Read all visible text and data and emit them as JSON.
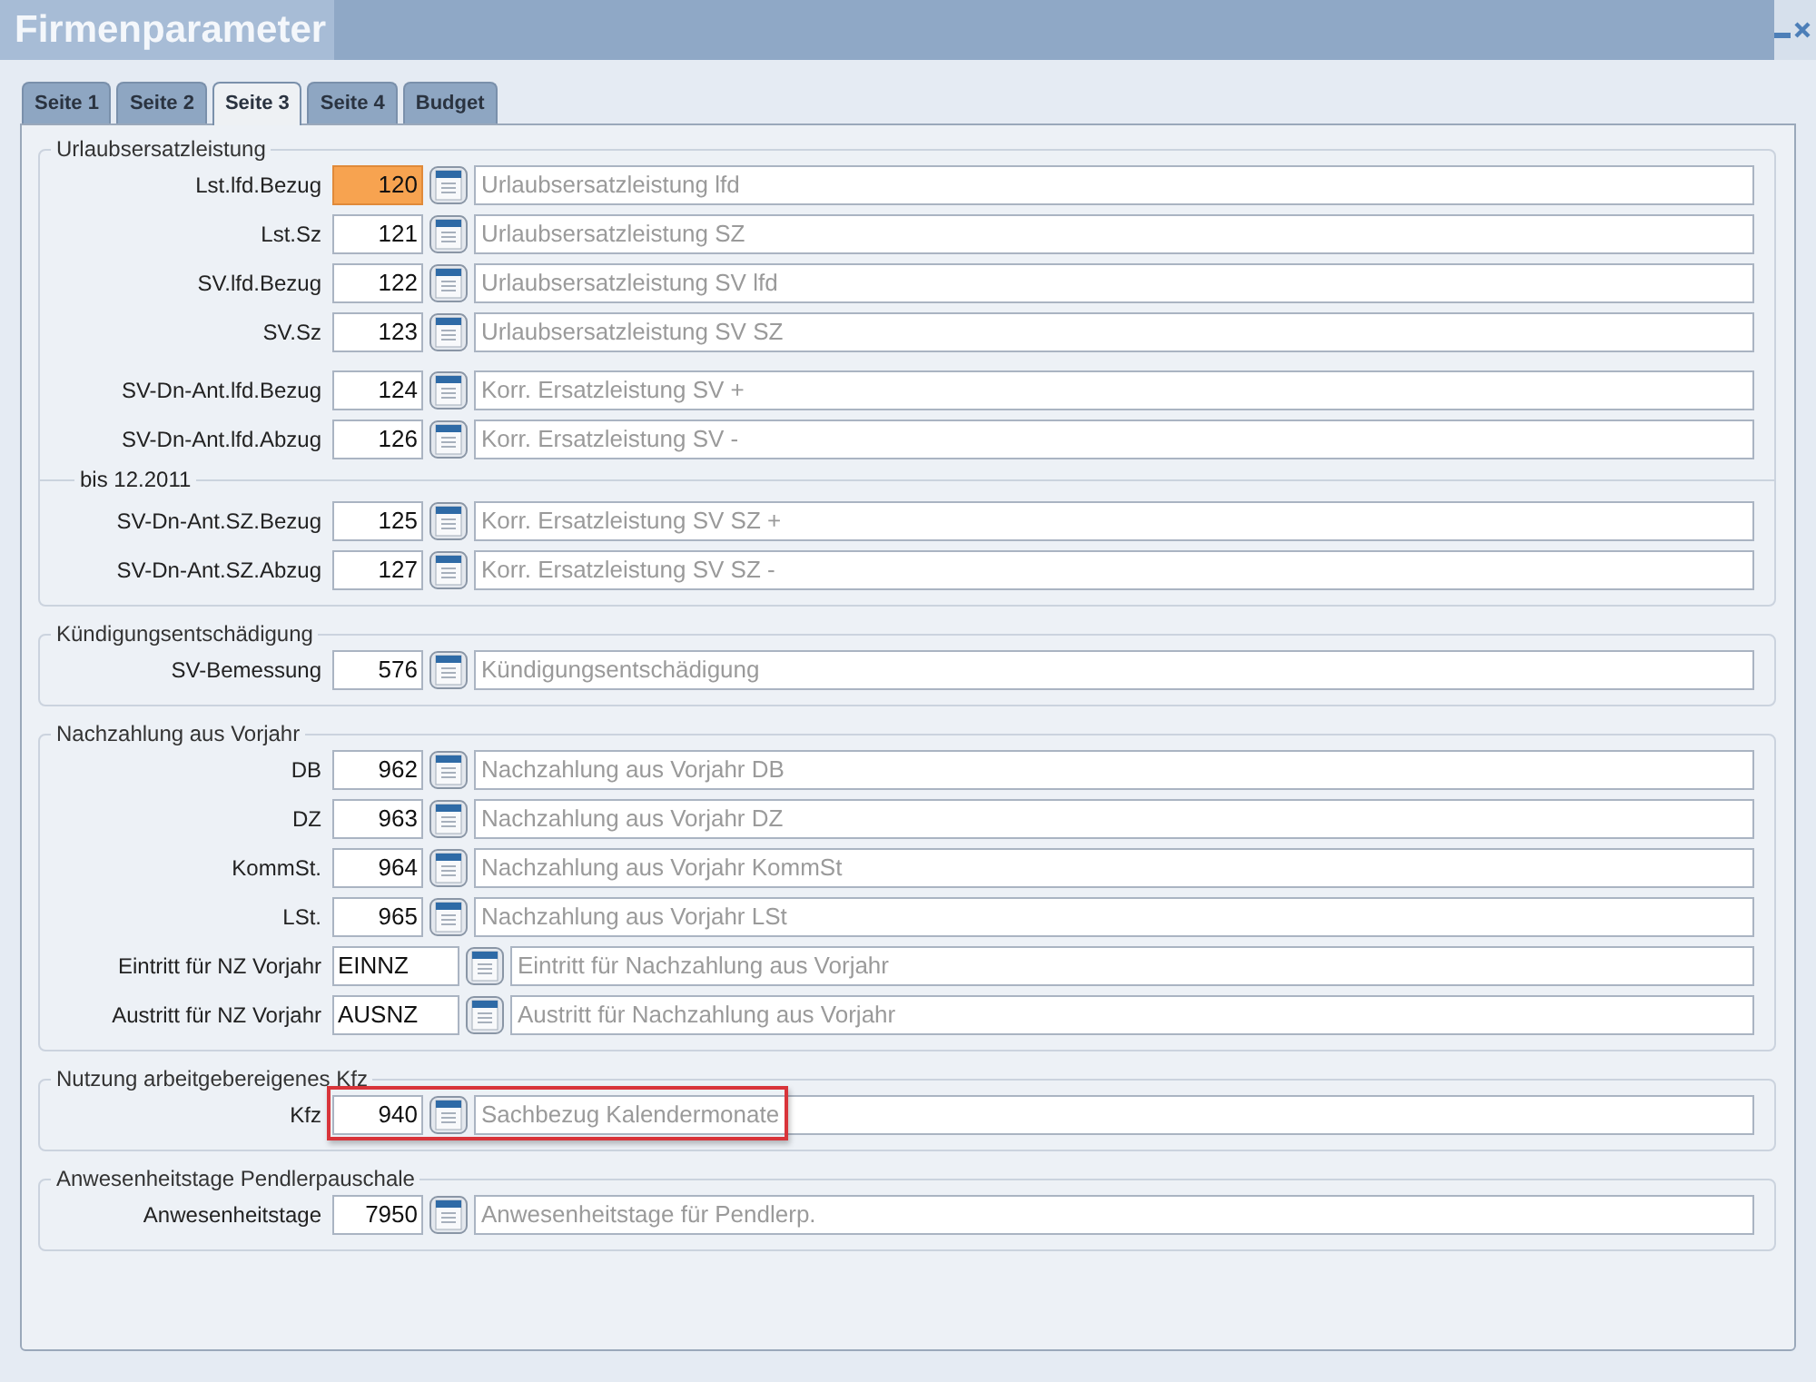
{
  "window": {
    "title": "Firmenparameter"
  },
  "tabs": [
    {
      "label": "Seite 1",
      "selected": false
    },
    {
      "label": "Seite 2",
      "selected": false
    },
    {
      "label": "Seite 3",
      "selected": true
    },
    {
      "label": "Seite 4",
      "selected": false
    },
    {
      "label": "Budget",
      "selected": false
    }
  ],
  "sections": [
    {
      "legend": "Urlaubsersatzleistung",
      "groups": [
        {
          "rows": [
            {
              "kind": "numeric",
              "label": "Lst.lfd.Bezug",
              "value": "120",
              "focused": true,
              "placeholder": "Urlaubsersatzleistung lfd",
              "highlighted": false
            },
            {
              "kind": "numeric",
              "label": "Lst.Sz",
              "value": "121",
              "focused": false,
              "placeholder": "Urlaubsersatzleistung SZ",
              "highlighted": false
            },
            {
              "kind": "numeric",
              "label": "SV.lfd.Bezug",
              "value": "122",
              "focused": false,
              "placeholder": "Urlaubsersatzleistung SV lfd",
              "highlighted": false
            },
            {
              "kind": "numeric",
              "label": "SV.Sz",
              "value": "123",
              "focused": false,
              "placeholder": "Urlaubsersatzleistung SV SZ",
              "highlighted": false
            }
          ]
        },
        {
          "rows": [
            {
              "kind": "numeric",
              "label": "SV-Dn-Ant.lfd.Bezug",
              "value": "124",
              "focused": false,
              "placeholder": "Korr. Ersatzleistung SV +",
              "highlighted": false
            },
            {
              "kind": "numeric",
              "label": "SV-Dn-Ant.lfd.Abzug",
              "value": "126",
              "focused": false,
              "placeholder": "Korr. Ersatzleistung SV -",
              "highlighted": false
            }
          ]
        },
        {
          "legend": "bis 12.2011",
          "rows": [
            {
              "kind": "numeric",
              "label": "SV-Dn-Ant.SZ.Bezug",
              "value": "125",
              "focused": false,
              "placeholder": "Korr. Ersatzleistung SV SZ +",
              "highlighted": false
            },
            {
              "kind": "numeric",
              "label": "SV-Dn-Ant.SZ.Abzug",
              "value": "127",
              "focused": false,
              "placeholder": "Korr. Ersatzleistung SV SZ -",
              "highlighted": false
            }
          ]
        }
      ]
    },
    {
      "legend": "Kündigungsentschädigung",
      "groups": [
        {
          "rows": [
            {
              "kind": "numeric",
              "label": "SV-Bemessung",
              "value": "576",
              "focused": false,
              "placeholder": "Kündigungsentschädigung",
              "highlighted": false
            }
          ]
        }
      ]
    },
    {
      "legend": "Nachzahlung aus Vorjahr",
      "groups": [
        {
          "rows": [
            {
              "kind": "numeric",
              "label": "DB",
              "value": "962",
              "focused": false,
              "placeholder": "Nachzahlung aus Vorjahr DB",
              "highlighted": false
            },
            {
              "kind": "numeric",
              "label": "DZ",
              "value": "963",
              "focused": false,
              "placeholder": "Nachzahlung aus Vorjahr DZ",
              "highlighted": false
            },
            {
              "kind": "numeric",
              "label": "KommSt.",
              "value": "964",
              "focused": false,
              "placeholder": "Nachzahlung aus Vorjahr KommSt",
              "highlighted": false
            },
            {
              "kind": "numeric",
              "label": "LSt.",
              "value": "965",
              "focused": false,
              "placeholder": "Nachzahlung aus Vorjahr LSt",
              "highlighted": false
            },
            {
              "kind": "text",
              "label": "Eintritt für NZ Vorjahr",
              "value": "EINNZ",
              "focused": false,
              "placeholder": "Eintritt für Nachzahlung aus Vorjahr",
              "highlighted": false
            },
            {
              "kind": "text",
              "label": "Austritt für NZ Vorjahr",
              "value": "AUSNZ",
              "focused": false,
              "placeholder": "Austritt für Nachzahlung aus Vorjahr",
              "highlighted": false
            }
          ]
        }
      ]
    },
    {
      "legend": "Nutzung arbeitgebereigenes Kfz",
      "groups": [
        {
          "rows": [
            {
              "kind": "numeric",
              "label": "Kfz",
              "value": "940",
              "focused": false,
              "placeholder": "Sachbezug Kalendermonate",
              "highlighted": true
            }
          ]
        }
      ]
    },
    {
      "legend": "Anwesenheitstage Pendlerpauschale",
      "groups": [
        {
          "rows": [
            {
              "kind": "numeric",
              "label": "Anwesenheitstage",
              "value": "7950",
              "focused": false,
              "placeholder": "Anwesenheitstage für Pendlerp.",
              "highlighted": false
            }
          ]
        }
      ]
    }
  ]
}
